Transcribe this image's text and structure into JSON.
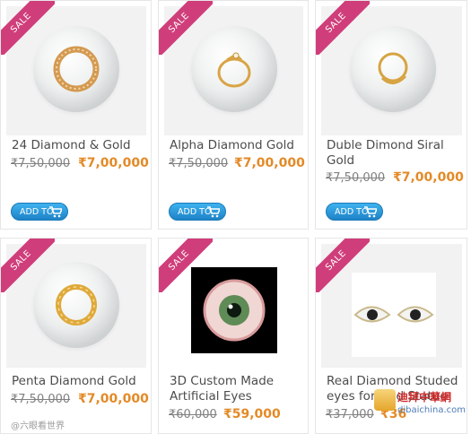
{
  "products": [
    {
      "badge": "SALE",
      "name": [
        "24 Diamond & Gold"
      ],
      "old_price": "₹7,50,000",
      "new_price": "₹7,00,000",
      "add_to_cart": "ADD TO"
    },
    {
      "badge": "SALE",
      "name": [
        "Alpha Diamond Gold"
      ],
      "old_price": "₹7,50,000",
      "new_price": "₹7,00,000",
      "add_to_cart": "ADD TO"
    },
    {
      "badge": "SALE",
      "name": [
        "Duble Dimond Siral",
        "Gold"
      ],
      "old_price": "₹7,50,000",
      "new_price": "₹7,00,000",
      "add_to_cart": "ADD TO"
    },
    {
      "badge": "SALE",
      "name": [
        "Penta Diamond Gold"
      ],
      "old_price": "₹7,50,000",
      "new_price": "₹7,00,000"
    },
    {
      "badge": "SALE",
      "name": [
        "3D Custom Made",
        "Artificial Eyes"
      ],
      "old_price": "₹60,000",
      "new_price": "₹59,000"
    },
    {
      "badge": "SALE",
      "name": [
        "Real Diamond Studed",
        "eyes for God Statue"
      ],
      "old_price": "₹37,000",
      "new_price": "₹36"
    }
  ],
  "watermark": {
    "left": "@六眼看世界",
    "logo_cn": "迪拜中華網",
    "logo_url": "dibaichina.com"
  },
  "colors": {
    "ribbon": "#cf3e7a",
    "price": "#e38a27",
    "button": "#1d82c7"
  }
}
